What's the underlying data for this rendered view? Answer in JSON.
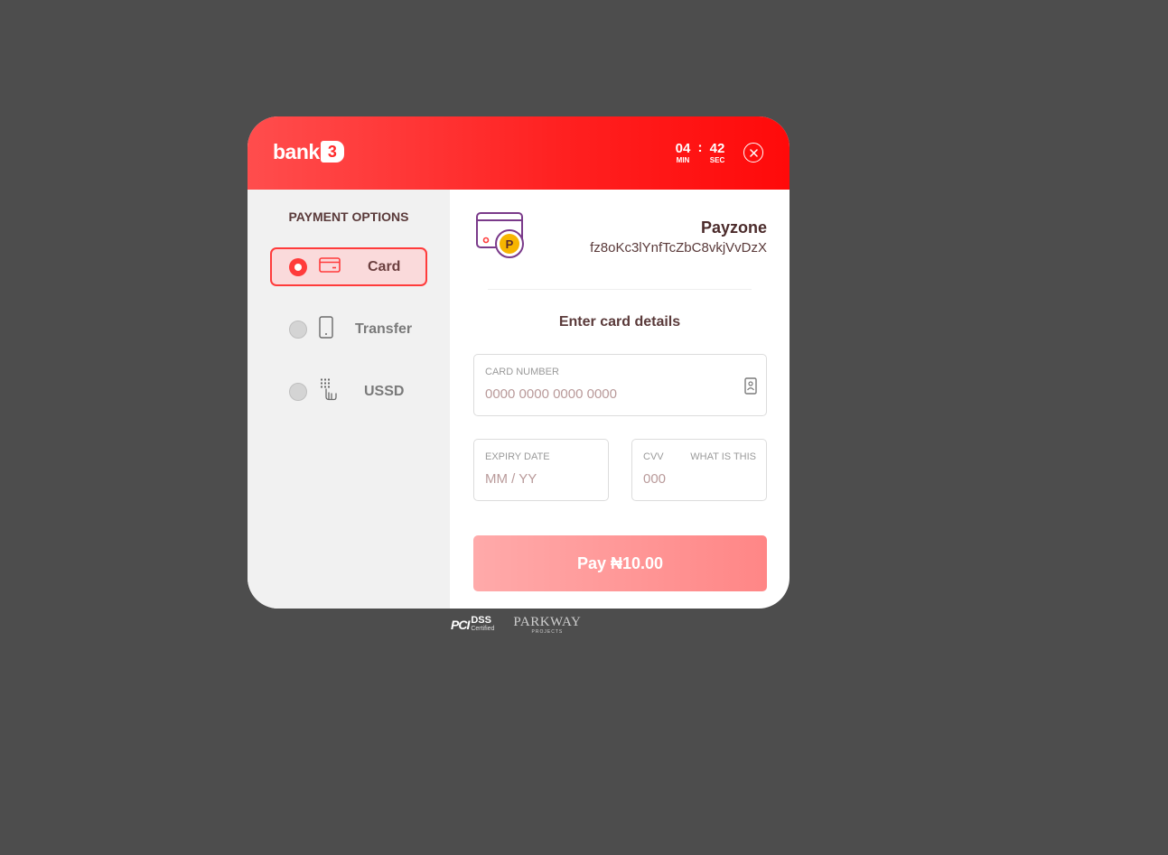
{
  "header": {
    "brand": "bank",
    "brand_mark": "3",
    "timer": {
      "minutes": "04",
      "seconds": "42",
      "separator": ":",
      "min_label": "MIN",
      "sec_label": "SEC"
    },
    "close_icon": "close-icon"
  },
  "sidebar": {
    "title": "PAYMENT OPTIONS",
    "options": [
      {
        "label": "Card",
        "icon": "credit-card-icon",
        "selected": true
      },
      {
        "label": "Transfer",
        "icon": "mobile-phone-icon",
        "selected": false
      },
      {
        "label": "USSD",
        "icon": "keypad-tap-icon",
        "selected": false
      }
    ]
  },
  "merchant": {
    "name": "Payzone",
    "reference": "fz8oKc3lYnfTcZbC8vkjVvDzX",
    "logo_icon": "payzone-logo-icon"
  },
  "form": {
    "title": "Enter card details",
    "card_number": {
      "label": "CARD NUMBER",
      "placeholder": "0000 0000 0000 0000"
    },
    "expiry": {
      "label": "EXPIRY DATE",
      "placeholder": "MM / YY"
    },
    "cvv": {
      "label": "CVV",
      "placeholder": "000",
      "help": "WHAT IS THIS"
    },
    "pay_label": "Pay ₦10.00"
  },
  "footer": {
    "pci": {
      "mark": "PCI",
      "line1": "DSS",
      "line2": "Certified"
    },
    "parkway": {
      "name": "PARKWAY",
      "tagline": "PROJECTS"
    }
  },
  "colors": {
    "accent": "#ff2a2a",
    "pay_button": "#ff9999",
    "background": "#4d4d4d"
  }
}
